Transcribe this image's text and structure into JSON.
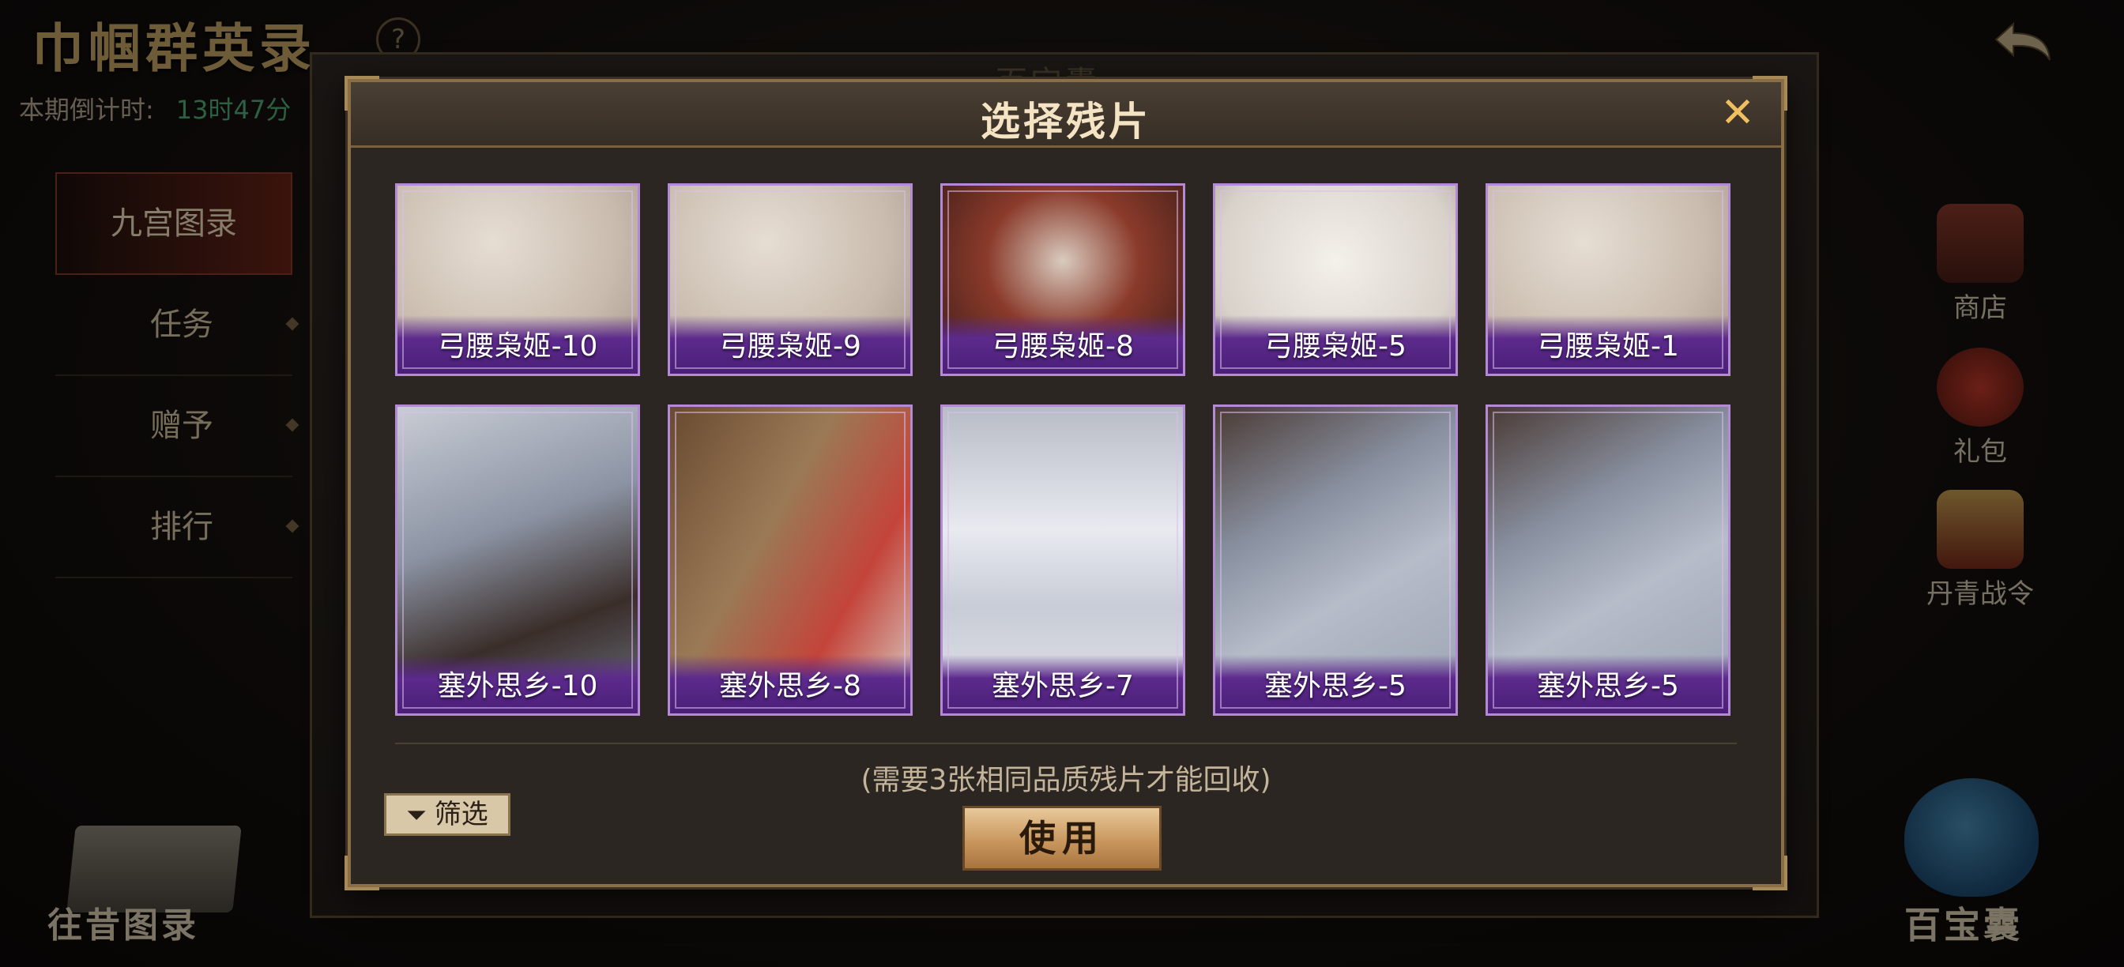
{
  "background": {
    "title": "巾帼群英录",
    "countdown_label": "本期倒计时:",
    "countdown_value": "13时47分",
    "side_menu": [
      {
        "label": "九宫图录",
        "active": true
      },
      {
        "label": "任务",
        "active": false
      },
      {
        "label": "赠予",
        "active": false
      },
      {
        "label": "排行",
        "active": false
      }
    ],
    "right_menu": [
      {
        "label": "商店",
        "icon": "chest-icon"
      },
      {
        "label": "礼包",
        "icon": "gift-pouch-icon"
      },
      {
        "label": "丹青战令",
        "icon": "order-token-icon"
      }
    ],
    "bottom_left_label": "往昔图录",
    "bottom_right_label": "百宝囊",
    "frame_title": "百宝囊"
  },
  "dialog": {
    "title": "选择残片",
    "cards": [
      {
        "label": "弓腰枭姬-10",
        "art": "art-pale"
      },
      {
        "label": "弓腰枭姬-9",
        "art": "art-pale"
      },
      {
        "label": "弓腰枭姬-8",
        "art": "art-red"
      },
      {
        "label": "弓腰枭姬-5",
        "art": "art-white"
      },
      {
        "label": "弓腰枭姬-1",
        "art": "art-pale"
      },
      {
        "label": "塞外思乡-10",
        "art": "art-snow1"
      },
      {
        "label": "塞外思乡-8",
        "art": "art-lute"
      },
      {
        "label": "塞外思乡-7",
        "art": "art-tent"
      },
      {
        "label": "塞外思乡-5",
        "art": "art-branch"
      },
      {
        "label": "塞外思乡-5",
        "art": "art-branch"
      }
    ],
    "hint": "(需要3张相同品质残片才能回收)",
    "filter_label": "筛选",
    "use_label": "使用"
  },
  "colors": {
    "card_border": "#b48ad4",
    "card_label_band": "#5c2a8c",
    "close_icon": "#f0c060",
    "use_button": "#c9975e"
  }
}
